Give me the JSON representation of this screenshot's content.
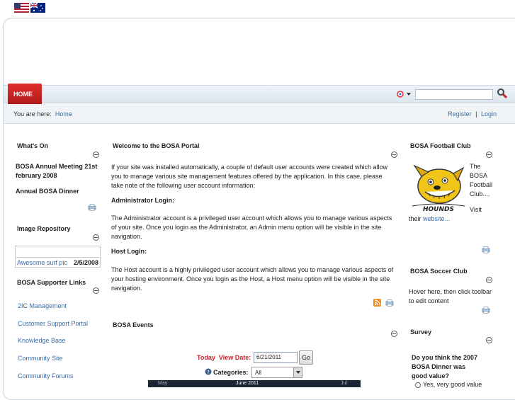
{
  "header": {
    "flags": [
      "us-flag-icon",
      "au-flag-icon"
    ]
  },
  "nav": {
    "home_label": "HOME",
    "search_value": ""
  },
  "breadcrumb": {
    "prefix": "You are here:",
    "home": "Home"
  },
  "account": {
    "register": "Register",
    "separator": "|",
    "login": "Login"
  },
  "left": {
    "whats_on": {
      "title": "What's On",
      "items": [
        "BOSA Annual Meeting 21st february 2008",
        "Annual BOSA Dinner"
      ]
    },
    "image_repo": {
      "title": "Image Repository",
      "item_label": "Awesome surf pic",
      "item_date": "2/5/2008"
    },
    "supporter_links": {
      "title": "BOSA Supporter Links",
      "links": [
        "2IC Management",
        "Customer Support Portal",
        "Knowledge Base",
        "Community Site",
        "Community Forums"
      ]
    }
  },
  "center": {
    "welcome": {
      "title": "Welcome to the BOSA Portal",
      "intro": "If your site was installed automatically, a couple of default user accounts were created which allow you to manage various site management features offered by the application. In this case, please take note of the following user account information:",
      "admin_heading": "Administrator Login:",
      "admin_text": "The Administrator account is a privileged user account which allows you to manage various aspects of your site. Once you login as the Administrator, an Admin menu option will be visible in the site navigation.",
      "host_heading": "Host Login:",
      "host_text": "The Host account is a highly privileged user account which allows you to manage various aspects of your hosting environment. Once you login as the Host, a Host menu option will be visible in the site navigation."
    },
    "events": {
      "title": "BOSA Events",
      "today": "Today",
      "view_date_label": "View Date:",
      "view_date_value": "6/21/2011",
      "go": "Go",
      "categories_label": "Categories:",
      "categories_value": "All",
      "cal_prev": "May",
      "cal_title": "June 2011",
      "cal_next": "Jul"
    }
  },
  "right": {
    "football": {
      "title": "BOSA Football Club",
      "text": "The BOSA Football Club....",
      "visit": "Visit",
      "their": "their",
      "website": "website...",
      "logo_text": "HOUNDS"
    },
    "soccer": {
      "title": "BOSA Soccer Club",
      "text": "Hover here, then click toolbar to edit content"
    },
    "survey": {
      "title": "Survey",
      "question": "Do you think the 2007 BOSA Dinner was good value?",
      "option1": "Yes, very good value"
    }
  },
  "colors": {
    "accent": "#c8202a",
    "link": "#3b6ea5",
    "navbar": "#e4ebf2"
  }
}
